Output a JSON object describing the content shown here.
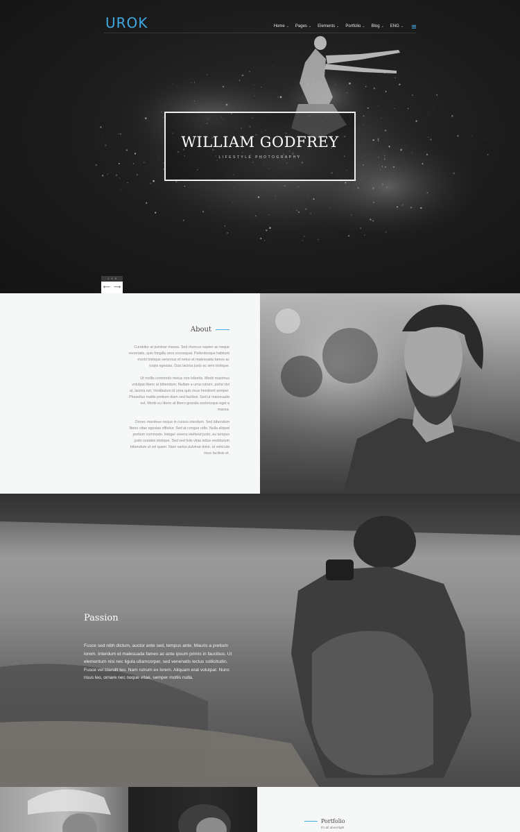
{
  "brand": {
    "logo": "UROK",
    "accent_color": "#3fa8e0"
  },
  "nav": {
    "items": [
      {
        "label": "Home"
      },
      {
        "label": "Pages"
      },
      {
        "label": "Elements"
      },
      {
        "label": "Portfolio"
      },
      {
        "label": "Blog"
      },
      {
        "label": "ENG"
      }
    ],
    "chevron_icon": "chevron-down-icon",
    "menu_icon": "hamburger-menu-icon"
  },
  "hero": {
    "title": "WILLIAM GODFREY",
    "subtitle": "LIFESTYLE PHOTOGRAPHY",
    "slider_pages": [
      "1",
      "2",
      "3"
    ],
    "prev_icon": "arrow-left-icon",
    "next_icon": "arrow-right-icon",
    "prev_glyph": "⟵",
    "next_glyph": "⟶"
  },
  "about": {
    "heading": "About",
    "paragraphs": [
      "Curabitur at pulvinar massa. Sed rhoncus sapien ac neque venenatis, quis fringilla urna consequat. Pellentesque habitant morbi tristique senectus et netus et malesuada fames ac turpis egestas. Duis lacinia justo ac sem tristique.",
      "Ut mollis commodo metus non lobortis. Morbi maximus volutpat libero at bibendum. Nullam a urna rutrum, porta nisl at, lacinia est. Vestibulum id urna quis risus hendrerit semper. Phasellus mattis pretium diam sed facilisis. Sed ut malesuada est. Morbi eu libero at libero gravida scelerisque eget a massa.",
      "Donec maximus neque in cursus interdum. Sed bibendum libero vitae egestas efficitur. Sed at congue odio. Nulla aliquet pretium commodo. Integer viverra eleifend justo, eu tempus justo sodales tristique. Sed sed felis vitae tellus vestibulum bibendum ut vel quam. Nam varius pulvinar dolor, at vehicula risus facilisis et."
    ]
  },
  "passion": {
    "heading": "Passion",
    "text": "Fusce sed nibh dictum, auctor ante sed, tempus ante. Mauris a pretium lorem. Interdum et malesuada fames ac ante ipsum primis in faucibus. Ut elementum nisi nec ligula ullamcorper, sed venenatis lectus sollicitudin. Fusce vel blandit leo. Nam rutrum ex lorem. Aliquam erat volutpat. Nunc risus leo, ornare nec neque vitae, semper mollis nulla."
  },
  "portfolio": {
    "heading": "Portfolio",
    "subheading": "It's all about light"
  }
}
